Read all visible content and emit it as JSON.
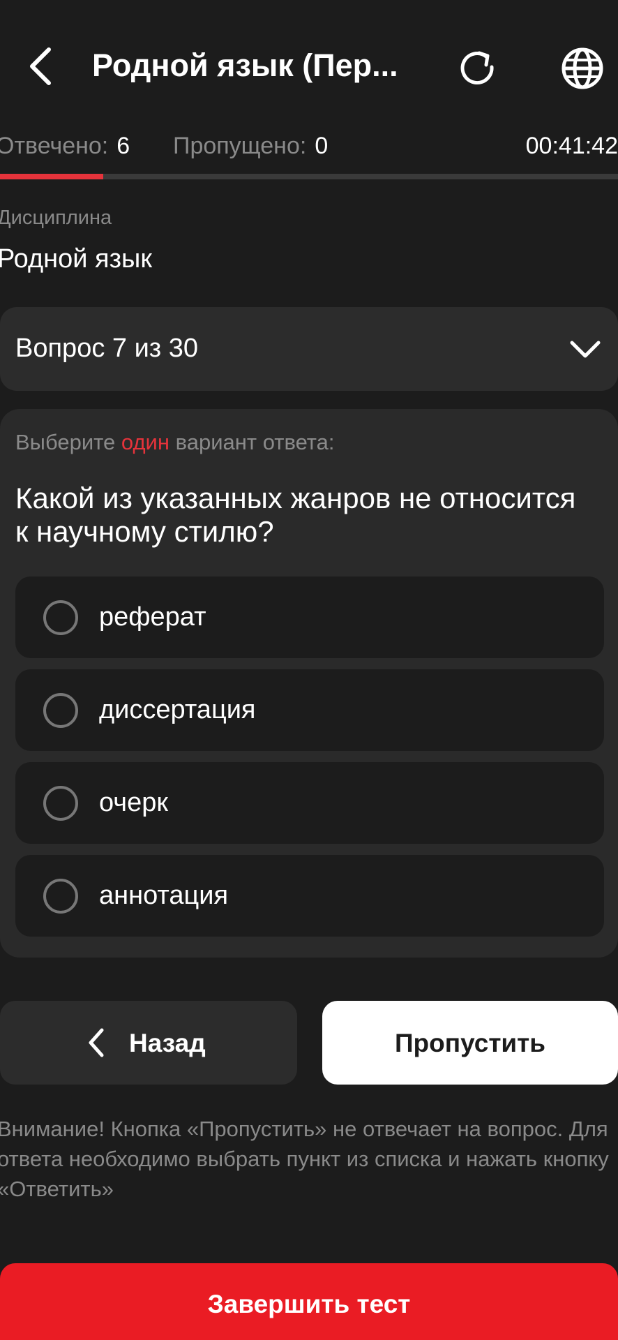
{
  "header": {
    "title": "Родной язык (Пер...",
    "back_icon": "chevron-left-icon",
    "refresh_icon": "refresh-icon",
    "language_icon": "globe-icon"
  },
  "stats": {
    "answered_label": "Отвечено:",
    "answered_value": "6",
    "skipped_label": "Пропущено:",
    "skipped_value": "0",
    "timer": "00:41:42"
  },
  "progress": {
    "fraction": 0.167,
    "fill_color": "#e5333b"
  },
  "discipline": {
    "label": "Дисциплина",
    "value": "Родной язык"
  },
  "question_selector": {
    "label": "Вопрос 7 из 30",
    "icon": "chevron-down-icon"
  },
  "question": {
    "instruction_prefix": "Выберите",
    "instruction_highlight": "один",
    "instruction_suffix": "вариант ответа:",
    "text": "Какой из указанных жанров не относится к научному стилю?",
    "options": [
      {
        "label": "реферат",
        "selected": false
      },
      {
        "label": "диссертация",
        "selected": false
      },
      {
        "label": "очерк",
        "selected": false
      },
      {
        "label": "аннотация",
        "selected": false
      }
    ]
  },
  "navigation": {
    "back_label": "Назад",
    "skip_label": "Пропустить"
  },
  "notice": "Внимание! Кнопка «Пропустить» не отвечает на вопрос. Для ответа необходимо выбрать пункт из списка и нажать кнопку «Ответить»",
  "finish_label": "Завершить тест",
  "colors": {
    "background": "#1c1c1c",
    "accent": "#ea1c24",
    "highlight": "#e5333b"
  }
}
